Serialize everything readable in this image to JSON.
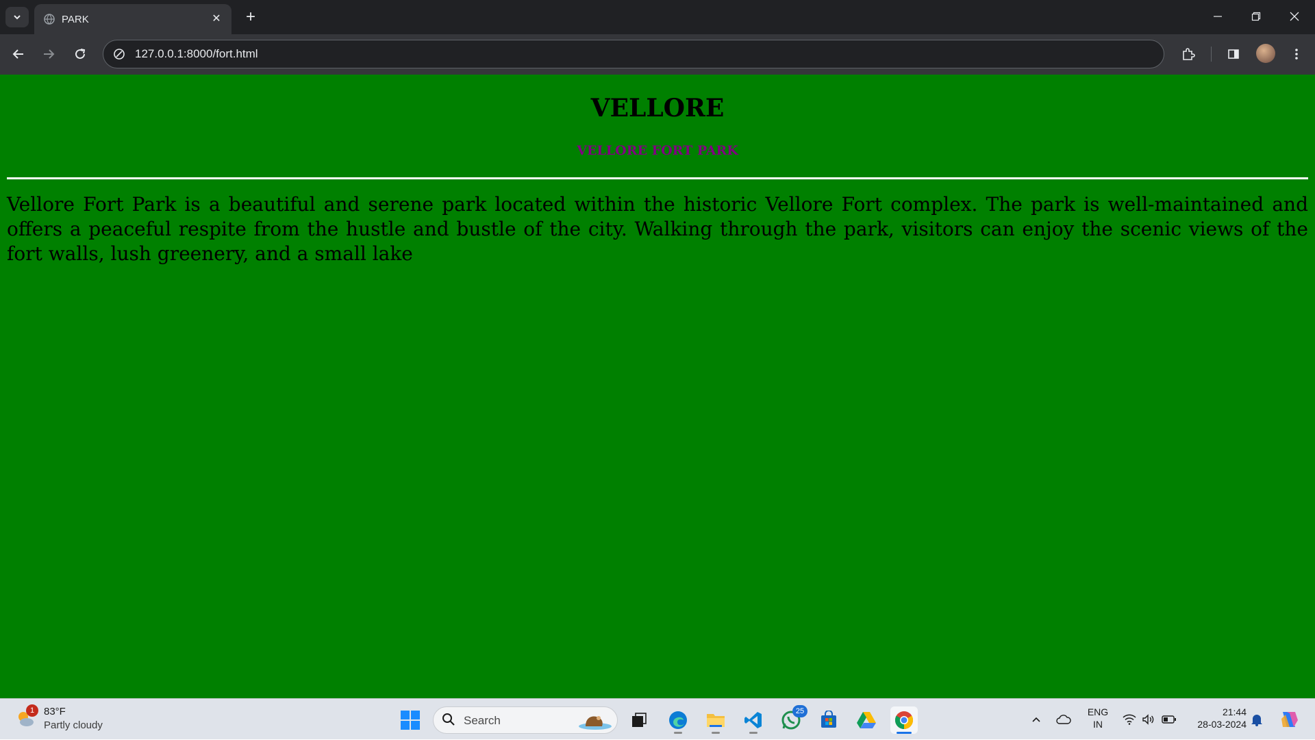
{
  "browser": {
    "tab_title": "PARK",
    "url": "127.0.0.1:8000/fort.html"
  },
  "page": {
    "heading": "VELLORE",
    "subheading": "VELLORE FORT PARK",
    "paragraph": "Vellore Fort Park is a beautiful and serene park located within the historic Vellore Fort complex. The park is well-maintained and offers a peaceful respite from the hustle and bustle of the city. Walking through the park, visitors can enjoy the scenic views of the fort walls, lush greenery, and a small lake",
    "background_color": "#008000",
    "subheading_color": "#800080"
  },
  "taskbar": {
    "weather": {
      "badge": "1",
      "temperature": "83°F",
      "condition": "Partly cloudy"
    },
    "search_label": "Search",
    "whatsapp_badge": "25",
    "language": {
      "line1": "ENG",
      "line2": "IN"
    },
    "clock": {
      "time": "21:44",
      "date": "28-03-2024"
    }
  }
}
